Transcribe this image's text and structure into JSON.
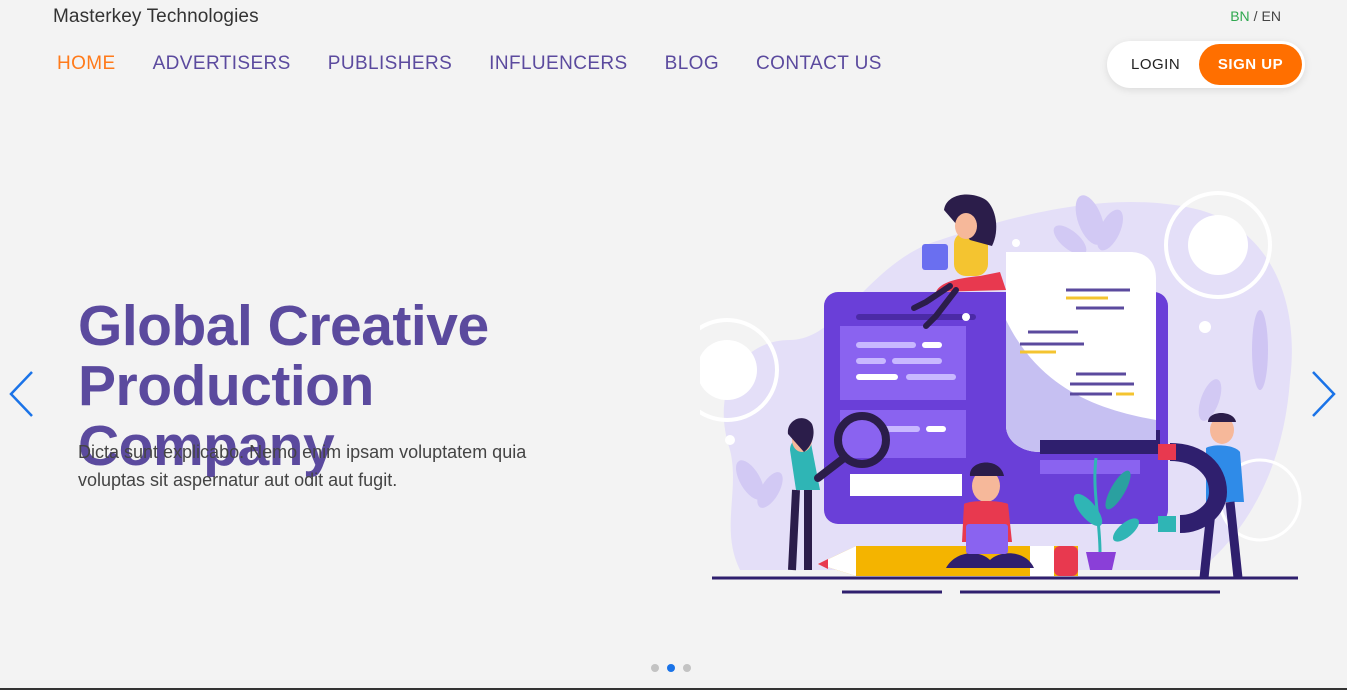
{
  "brand": "Masterkey Technologies",
  "lang": {
    "bn": "BN",
    "sep": "/",
    "en": "EN"
  },
  "nav": {
    "home": "HOME",
    "advertisers": "ADVERTISERS",
    "publishers": "PUBLISHERS",
    "influencers": "INFLUENCERS",
    "blog": "BLOG",
    "contact": "CONTACT US"
  },
  "auth": {
    "login": "LOGIN",
    "signup": "SIGN UP"
  },
  "hero": {
    "title_line1": "Global Creative",
    "title_line2": "Production Company",
    "subtitle": "Dicta sunt explicabo. Nemo enim ipsam voluptatem quia voluptas sit aspernatur aut odit aut fugit."
  },
  "carousel": {
    "slides": 3,
    "active": 2
  },
  "colors": {
    "accent": "#ff6f00",
    "nav": "#5b4a9e",
    "lang_active": "#2fa84f",
    "arrow": "#1a73e8",
    "illustration_purple": "#6a3fd8"
  }
}
